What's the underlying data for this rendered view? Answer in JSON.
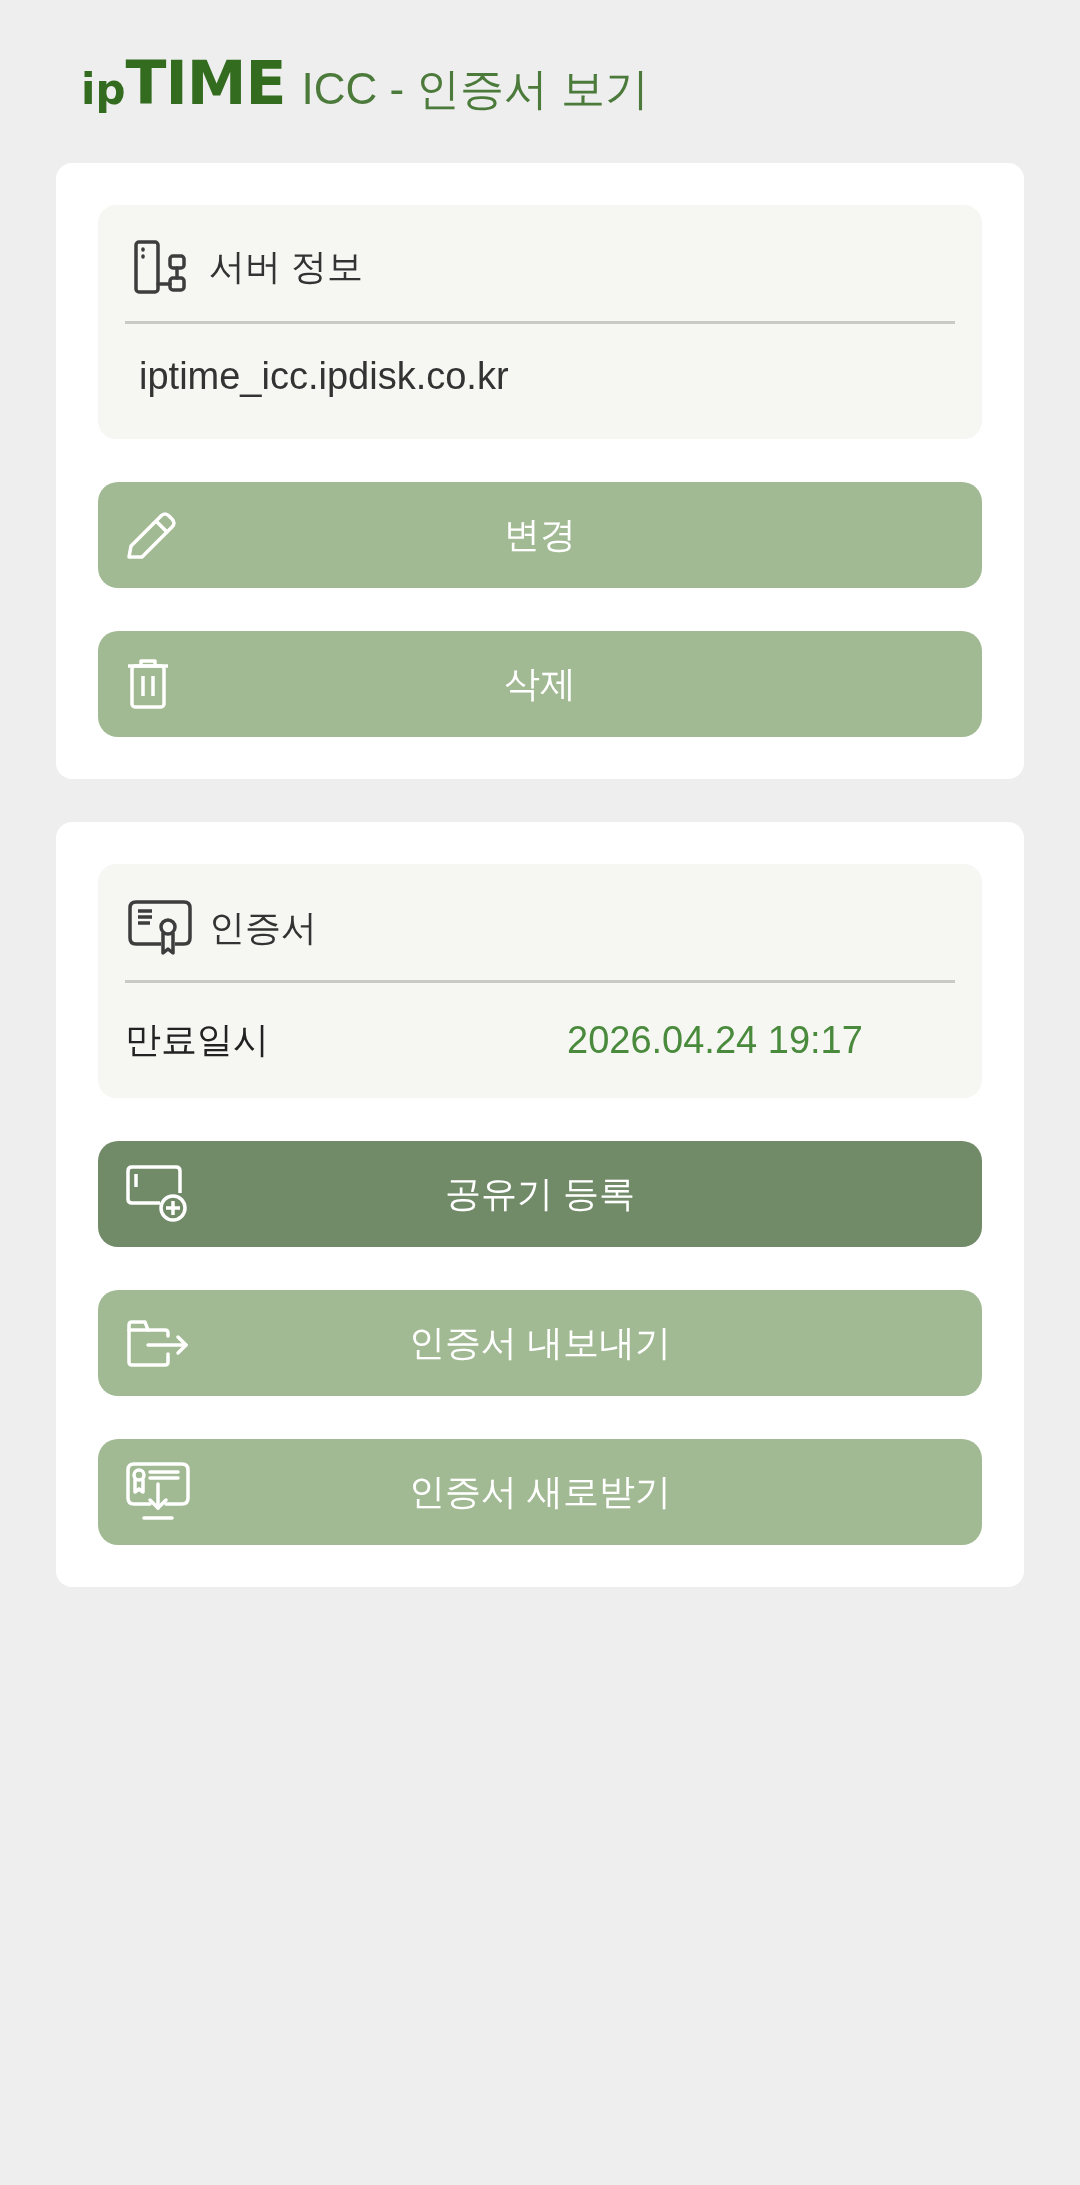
{
  "header": {
    "logo": {
      "prefix": "ip",
      "name": "TIME"
    },
    "title": "ICC - 인증서 보기"
  },
  "server_card": {
    "info": {
      "title": "서버 정보",
      "value": "iptime_icc.ipdisk.co.kr"
    },
    "buttons": [
      {
        "label": "변경",
        "pressed": false
      },
      {
        "label": "삭제",
        "pressed": false
      }
    ]
  },
  "certificate_card": {
    "info": {
      "title": "인증서",
      "rows": [
        {
          "label": "만료일시",
          "value": "2026.04.24 19:17"
        }
      ]
    },
    "buttons": [
      {
        "label": "공유기 등록",
        "pressed": true
      },
      {
        "label": "인증서 내보내기",
        "pressed": false
      },
      {
        "label": "인증서 새로받기",
        "pressed": false
      }
    ]
  }
}
